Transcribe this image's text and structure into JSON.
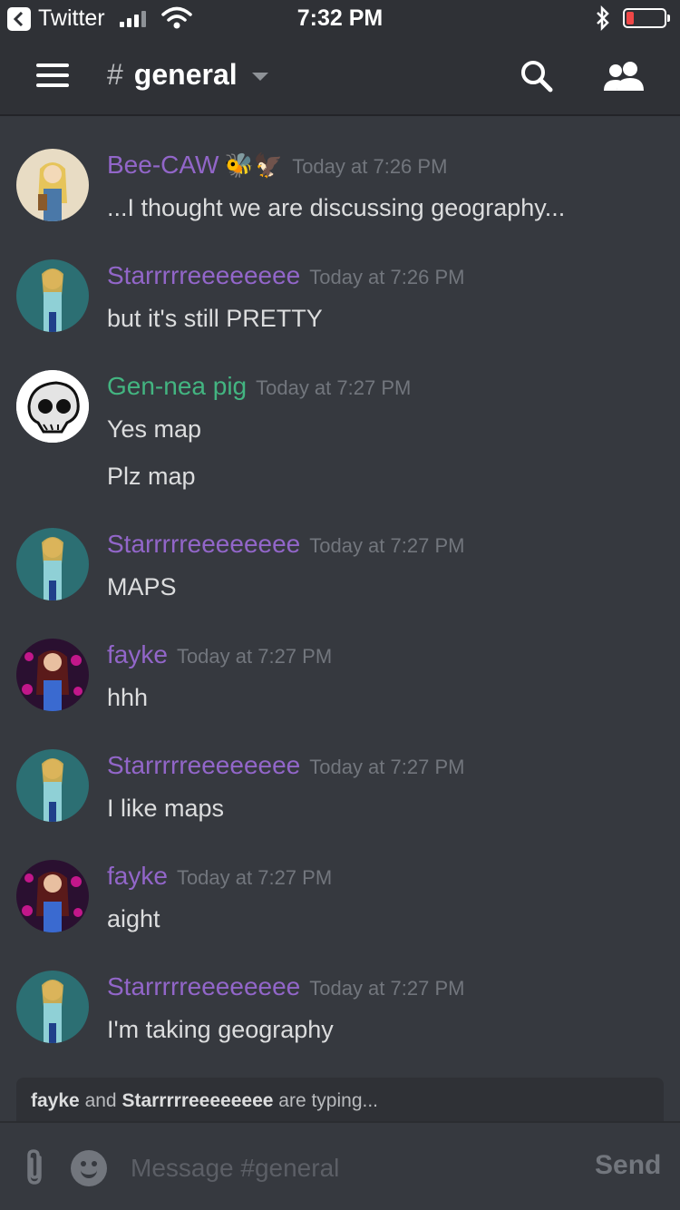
{
  "status_bar": {
    "back_app": "Twitter",
    "time": "7:32 PM"
  },
  "header": {
    "channel_hash": "#",
    "channel_name": "general"
  },
  "messages": [
    {
      "username": "Bee-CAW",
      "emoji": "🐝🦅",
      "timestamp": "Today at 7:26 PM",
      "lines": [
        "...I thought we are discussing geography..."
      ],
      "avatar": "bee-caw-avatar"
    },
    {
      "username": "Starrrrreeeeeeee",
      "timestamp": "Today at 7:26 PM",
      "lines": [
        "but it's still PRETTY"
      ],
      "avatar": "starr-avatar"
    },
    {
      "username": "Gen-nea pig",
      "timestamp": "Today at 7:27 PM",
      "lines": [
        "Yes map",
        "Plz map"
      ],
      "avatar": "skull-avatar"
    },
    {
      "username": "Starrrrreeeeeeee",
      "timestamp": "Today at 7:27 PM",
      "lines": [
        "MAPS"
      ],
      "avatar": "starr-avatar"
    },
    {
      "username": "fayke",
      "timestamp": "Today at 7:27 PM",
      "lines": [
        "hhh"
      ],
      "avatar": "fayke-avatar"
    },
    {
      "username": "Starrrrreeeeeeee",
      "timestamp": "Today at 7:27 PM",
      "lines": [
        "I like maps"
      ],
      "avatar": "starr-avatar"
    },
    {
      "username": "fayke",
      "timestamp": "Today at 7:27 PM",
      "lines": [
        "aight"
      ],
      "avatar": "fayke-avatar"
    },
    {
      "username": "Starrrrreeeeeeee",
      "timestamp": "Today at 7:27 PM",
      "lines": [
        "I'm taking geography"
      ],
      "avatar": "starr-avatar"
    }
  ],
  "typing": {
    "user1": "fayke",
    "and": "and",
    "user2": "Starrrrreeeeeeee",
    "suffix": "are typing..."
  },
  "composer": {
    "placeholder": "Message #general",
    "send_label": "Send"
  },
  "colors": {
    "background": "#36393f",
    "header": "#2f3136",
    "username_purple": "#9266c9",
    "username_green": "#43b581",
    "timestamp": "#72767d"
  }
}
